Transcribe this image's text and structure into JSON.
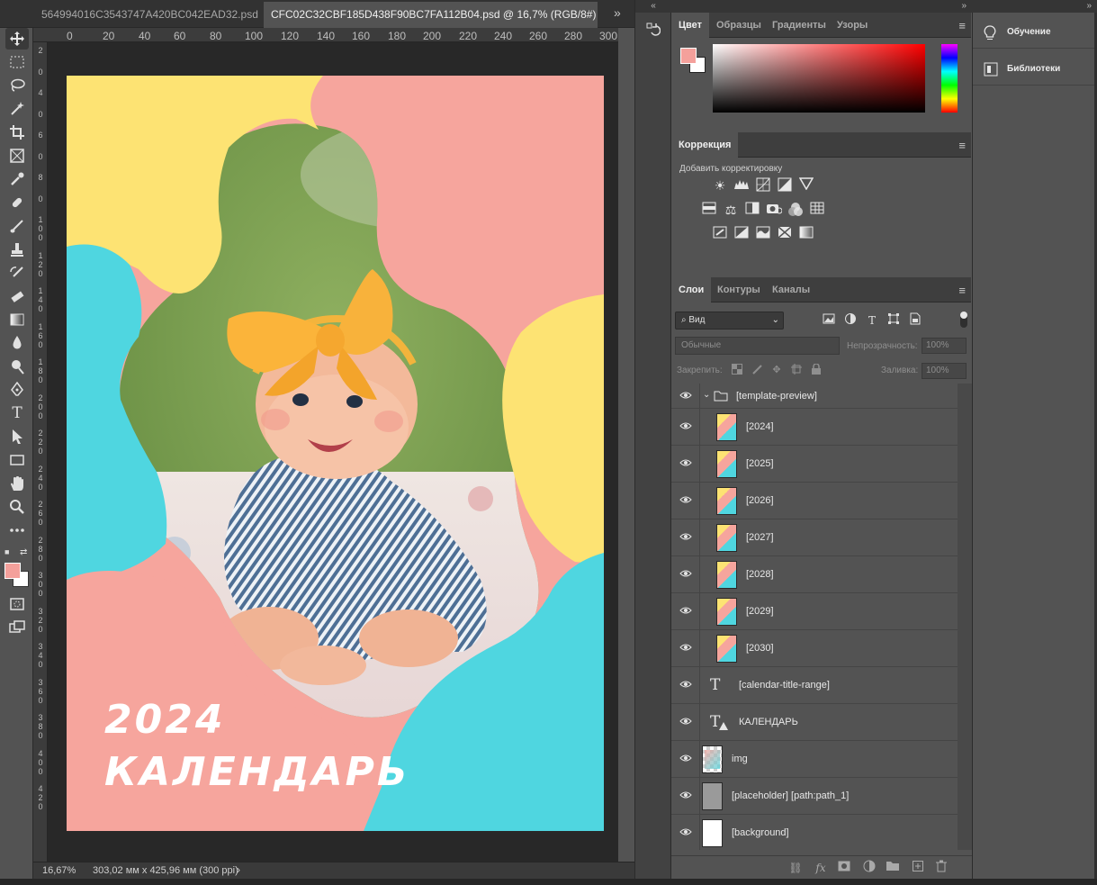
{
  "tabs": [
    {
      "label": "564994016C3543747A420BC042EAD32.psd",
      "active": false
    },
    {
      "label": "CFC02C32CBF185D438F90BC7FA112B04.psd @ 16,7% (RGB/8#) *",
      "active": true
    }
  ],
  "tab_close_glyph": "×",
  "tab_overflow_glyph": "»",
  "ruler_top": [
    "0",
    "20",
    "40",
    "60",
    "80",
    "100",
    "120",
    "140",
    "160",
    "180",
    "200",
    "220",
    "240",
    "260",
    "280",
    "300"
  ],
  "ruler_left": [
    "2",
    "0",
    "4",
    "0",
    "6",
    "0",
    "8",
    "0",
    "1\n0\n0",
    "1\n2\n0",
    "1\n4\n0",
    "1\n6\n0",
    "1\n8\n0",
    "2\n0\n0",
    "2\n2\n0",
    "2\n4\n0",
    "2\n6\n0",
    "2\n8\n0",
    "3\n0\n0",
    "3\n2\n0",
    "3\n4\n0",
    "3\n6\n0",
    "3\n8\n0",
    "4\n0\n0",
    "4\n2\n0"
  ],
  "canvas": {
    "year": "2024",
    "title": "КАЛЕНДАРЬ",
    "colors": {
      "pink": "#f6a59d",
      "yellow": "#fde373",
      "cyan": "#4fd6e0"
    }
  },
  "status": {
    "zoom": "16,67%",
    "doc_size": "303,02 мм x 425,96 мм (300 ppi)",
    "arrow": "›"
  },
  "color_panel": {
    "tabs": [
      "Цвет",
      "Образцы",
      "Градиенты",
      "Узоры"
    ],
    "foreground": "#f4a09b",
    "background": "#ffffff"
  },
  "adjustments": {
    "tab": "Коррекция",
    "hint": "Добавить корректировку"
  },
  "layers_panel": {
    "tabs": [
      "Слои",
      "Контуры",
      "Каналы"
    ],
    "filter_label": "Вид",
    "blend_mode": "Обычные",
    "opacity_label": "Непрозрачность:",
    "opacity_value": "100%",
    "lock_label": "Закрепить:",
    "fill_label": "Заливка:",
    "fill_value": "100%",
    "layers": [
      {
        "name": "[template-preview]",
        "kind": "group"
      },
      {
        "name": "[2024]",
        "kind": "smart"
      },
      {
        "name": "[2025]",
        "kind": "smart"
      },
      {
        "name": "[2026]",
        "kind": "smart"
      },
      {
        "name": "[2027]",
        "kind": "smart"
      },
      {
        "name": "[2028]",
        "kind": "smart"
      },
      {
        "name": "[2029]",
        "kind": "smart"
      },
      {
        "name": "[2030]",
        "kind": "smart"
      },
      {
        "name": "[calendar-title-range]",
        "kind": "text"
      },
      {
        "name": "КАЛЕНДАРЬ",
        "kind": "text-warning"
      },
      {
        "name": "img",
        "kind": "image"
      },
      {
        "name": "[placeholder] [path:path_1]",
        "kind": "gray"
      },
      {
        "name": "[background]",
        "kind": "white"
      }
    ]
  },
  "side_panel": {
    "items": [
      {
        "label": "Обучение",
        "icon": "lightbulb-icon"
      },
      {
        "label": "Библиотеки",
        "icon": "libraries-icon"
      }
    ]
  },
  "icons": {
    "collapse": "«",
    "expand": "»",
    "menu": "≡",
    "eye": "👁",
    "type_tool": "T",
    "chevron": "⌄"
  }
}
